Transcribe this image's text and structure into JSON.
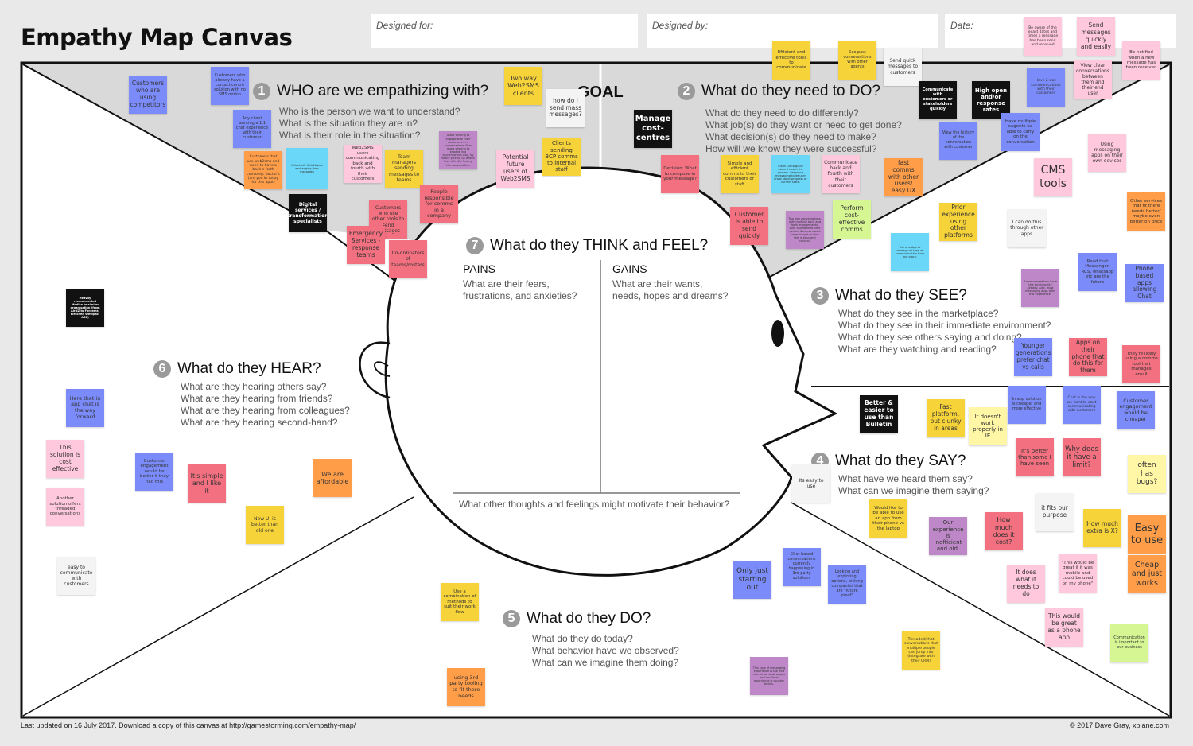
{
  "header": {
    "title": "Empathy Map Canvas",
    "designed_for_label": "Designed for:",
    "designed_by_label": "Designed by:",
    "date_label": "Date:"
  },
  "goal_label": "GOAL",
  "sections": {
    "who": {
      "number": "1",
      "title": "WHO are we empathizing with?",
      "questions": [
        "Who is the person we want to understand?",
        "What is the situation they are in?",
        "What is their role in the situation?"
      ]
    },
    "do_need": {
      "number": "2",
      "title": "What do they need to DO?",
      "questions": [
        "What do they need to do differently?",
        "What job(s) do they want or need to get done?",
        "What decision(s) do they need to make?",
        "How will we know they were successful?"
      ]
    },
    "see": {
      "number": "3",
      "title": "What do they SEE?",
      "questions": [
        "What do they see in the marketplace?",
        "What do they see in their immediate environment?",
        "What do they see others saying and doing?",
        "What are they watching and reading?"
      ]
    },
    "say": {
      "number": "4",
      "title": "What do they SAY?",
      "questions": [
        "What have we heard them say?",
        "What can we imagine them saying?"
      ]
    },
    "do": {
      "number": "5",
      "title": "What do they DO?",
      "questions": [
        "What do they do today?",
        "What behavior have we observed?",
        "What can we imagine them doing?"
      ]
    },
    "hear": {
      "number": "6",
      "title": "What do they HEAR?",
      "questions": [
        "What are they hearing others say?",
        "What are they hearing from friends?",
        "What are they hearing from colleagues?",
        "What are they hearing second-hand?"
      ]
    },
    "think": {
      "number": "7",
      "title": "What do they THINK and FEEL?",
      "pains_label": "PAINS",
      "pains_q": [
        "What are their fears,",
        "frustrations, and anxieties?"
      ],
      "gains_label": "GAINS",
      "gains_q": [
        "What are their wants,",
        "needs, hopes and dreams?"
      ],
      "other": "What other thoughts and feelings might motivate their behavior?"
    }
  },
  "colors": {
    "blue": "#7b8cfa",
    "pink": "#ffc8dc",
    "yellow": "#f7d33a",
    "lightyellow": "#fff6a6",
    "orange": "#ff9d48",
    "red": "#f2707f",
    "purple": "#be88c8",
    "cyan": "#6bd7f8",
    "black": "#111111",
    "white": "#f4f4f5",
    "green": "#d5f692"
  },
  "notes": [
    {
      "text": "Customers who are using competitors",
      "color": "blue",
      "section": "who"
    },
    {
      "text": "Customers who already have a contact centre solution with no SMS option",
      "color": "blue",
      "section": "who"
    },
    {
      "text": "Any client wanting a 1:1 chat experience with their customer",
      "color": "blue",
      "section": "who"
    },
    {
      "text": "Customers that use web2sms and need to have a back n forth convo eg: doctor's (are you in today for this appt)",
      "color": "orange",
      "section": "who"
    },
    {
      "text": "Potentially Web2Users exchanging their messages",
      "color": "cyan",
      "section": "who"
    },
    {
      "text": "Web2SMS users communicating back and fourth with their customers",
      "color": "pink",
      "section": "who"
    },
    {
      "text": "Team managers sending messages to teams",
      "color": "yellow",
      "section": "who"
    },
    {
      "text": "Users wishing to engage with their customers in a conversational flow. Users wishing to engage in a asynchronous way, by easily picking up where they left off / finding the conversation",
      "color": "purple",
      "section": "who"
    },
    {
      "text": "Two way Web2SMS clients",
      "color": "yellow",
      "section": "who"
    },
    {
      "text": "how do i send mass messages?",
      "color": "white",
      "section": "who"
    },
    {
      "text": "Clients sending BCP comms to internal staff",
      "color": "yellow",
      "section": "who"
    },
    {
      "text": "Potential future users of Web2SMS",
      "color": "pink",
      "section": "who"
    },
    {
      "text": "People responsible for comms in a company",
      "color": "red",
      "section": "who"
    },
    {
      "text": "Digital services / transformation specialists",
      "color": "black",
      "section": "who"
    },
    {
      "text": "Customers who use other tools to send messages",
      "color": "red",
      "section": "who"
    },
    {
      "text": "Emergency Services - response teams",
      "color": "red",
      "section": "who"
    },
    {
      "text": "Co-ordinators of teams/rosters",
      "color": "red",
      "section": "who"
    },
    {
      "text": "Efficient and effective tools to communicate",
      "color": "yellow",
      "section": "do_need"
    },
    {
      "text": "See past conversations with other agents",
      "color": "yellow",
      "section": "do_need"
    },
    {
      "text": "Send quick messages to customers",
      "color": "white",
      "section": "do_need"
    },
    {
      "text": "Communicate with customers or stakeholders quickly",
      "color": "black",
      "section": "do_need"
    },
    {
      "text": "High open and/or response rates",
      "color": "black",
      "section": "do_need"
    },
    {
      "text": "Be aware of the exact dates and times a message has been send and received",
      "color": "pink",
      "section": "do_need"
    },
    {
      "text": "Send messages quickly and easily",
      "color": "pink",
      "section": "do_need"
    },
    {
      "text": "Be notified when a new message has been received",
      "color": "pink",
      "section": "do_need"
    },
    {
      "text": "Have 2 way communications with their customers",
      "color": "blue",
      "section": "do_need"
    },
    {
      "text": "View clear conversations between them and their end user",
      "color": "pink",
      "section": "do_need"
    },
    {
      "text": "View the history of the conversation with customer",
      "color": "blue",
      "section": "do_need"
    },
    {
      "text": "Have multiple cagents be able to carry on the conversation",
      "color": "blue",
      "section": "do_need"
    },
    {
      "text": "Manage cost-centres",
      "color": "black",
      "section": "do_need"
    },
    {
      "text": "Decision: What to compose in your message?",
      "color": "red",
      "section": "do_need"
    },
    {
      "text": "Simple and efficient comms to their customers or staff",
      "color": "yellow",
      "section": "do_need"
    },
    {
      "text": "Clean UX to guide users through the process. Response messaging to let user know about progress or current state.",
      "color": "cyan",
      "section": "do_need"
    },
    {
      "text": "Communicate back and fourth with their customers",
      "color": "pink",
      "section": "do_need"
    },
    {
      "text": "fast comms with other users/ easy UX",
      "color": "orange",
      "section": "do_need"
    },
    {
      "text": "Customer is able to send quickly",
      "color": "red",
      "section": "do_need"
    },
    {
      "text": "Two way conversations, with multiple back and forth engagements, over a undefined time period. Success would be making it so that this is easy and natural.",
      "color": "purple",
      "section": "do_need"
    },
    {
      "text": "Perform cost-effective comms",
      "color": "green",
      "section": "do_need"
    },
    {
      "text": "Use one App to manage all type of communication from one place.",
      "color": "cyan",
      "section": "see"
    },
    {
      "text": "Prior experience using other platforms",
      "color": "yellow",
      "section": "see"
    },
    {
      "text": "CMS tools",
      "color": "pink",
      "section": "see"
    },
    {
      "text": "Using messaging apps on their own devices",
      "color": "pink",
      "section": "see"
    },
    {
      "text": "I can do this through other apps",
      "color": "white",
      "section": "see"
    },
    {
      "text": "Other services that fit there needs better/ maybe even better on price",
      "color": "orange",
      "section": "see"
    },
    {
      "text": "Some competitors have this functionality already. Also, most messaging apps offer this experience.",
      "color": "purple",
      "section": "see"
    },
    {
      "text": "Read that Messanger, RCS, whatsapp etc are the future",
      "color": "blue",
      "section": "see"
    },
    {
      "text": "Phone based apps allowing Chat",
      "color": "blue",
      "section": "see"
    },
    {
      "text": "Younger generations prefer chat vs calls",
      "color": "blue",
      "section": "see"
    },
    {
      "text": "Apps on their phone that do this for them",
      "color": "red",
      "section": "see"
    },
    {
      "text": "They're likely using a comms tool that manages email",
      "color": "red",
      "section": "see"
    },
    {
      "text": "Better & easier to use than Bulletin",
      "color": "black",
      "section": "say"
    },
    {
      "text": "Fast platform, but clunky in areas",
      "color": "yellow",
      "section": "say"
    },
    {
      "text": "It doesn't work properly in IE",
      "color": "lightyellow",
      "section": "say"
    },
    {
      "text": "In app solution is cheaper and more effective",
      "color": "blue",
      "section": "say"
    },
    {
      "text": "Chat is the way we want to start communicating with customers",
      "color": "blue",
      "section": "say"
    },
    {
      "text": "Customer engagement would be cheaper",
      "color": "blue",
      "section": "say"
    },
    {
      "text": "It's better than some I have seen",
      "color": "red",
      "section": "say"
    },
    {
      "text": "Why does it have a limit?",
      "color": "red",
      "section": "say"
    },
    {
      "text": "often has bugs?",
      "color": "lightyellow",
      "section": "say"
    },
    {
      "text": "Its easy to use",
      "color": "white",
      "section": "say"
    },
    {
      "text": "Would like to be able to use an app from their phone vs the laptop",
      "color": "yellow",
      "section": "say"
    },
    {
      "text": "Our experience is inefficient and old.",
      "color": "purple",
      "section": "say"
    },
    {
      "text": "How much does it cost?",
      "color": "red",
      "section": "say"
    },
    {
      "text": "it fits our purpose",
      "color": "white",
      "section": "say"
    },
    {
      "text": "How much extra is X?",
      "color": "yellow",
      "section": "say"
    },
    {
      "text": "Easy to use",
      "color": "orange",
      "section": "say"
    },
    {
      "text": "Cheap and just works",
      "color": "orange",
      "section": "say"
    },
    {
      "text": "It does what it needs to do",
      "color": "pink",
      "section": "say"
    },
    {
      "text": "\"This would be great if it was mobile and could be used on my phone\"",
      "color": "pink",
      "section": "say"
    },
    {
      "text": "This would be great as a phone app",
      "color": "pink",
      "section": "say"
    },
    {
      "text": "Communication is important to our business",
      "color": "green",
      "section": "say"
    },
    {
      "text": "Threaded/chat conversations that multiple people can jump into (integrate with their CRM)",
      "color": "yellow",
      "section": "do"
    },
    {
      "text": "Only just starting out",
      "color": "blue",
      "section": "do"
    },
    {
      "text": "Chat based conversations currently happening in 3rd party solutions",
      "color": "blue",
      "section": "do"
    },
    {
      "text": "Looking and exploring options, picking companies that are \"future proof\"",
      "color": "blue",
      "section": "do"
    },
    {
      "text": "This type of messaging experience is the new normal for most people and our Omni experience is counter to this.",
      "color": "purple",
      "section": "do"
    },
    {
      "text": "Use a combination of methods to suit their work flow",
      "color": "yellow",
      "section": "do"
    },
    {
      "text": "using 3rd party tooling to fit there needs",
      "color": "orange",
      "section": "do"
    },
    {
      "text": "Heavily recommended Modica to similar organisation (from AirNZ to Fonterra, Fletcher, Westpac, ASB)",
      "color": "black",
      "section": "hear"
    },
    {
      "text": "Here that in app chat is the way forward",
      "color": "blue",
      "section": "hear"
    },
    {
      "text": "This solution is cost effective",
      "color": "pink",
      "section": "hear"
    },
    {
      "text": "Another solution offers threaded conversations",
      "color": "pink",
      "section": "hear"
    },
    {
      "text": "easy to communicate with customers",
      "color": "white",
      "section": "hear"
    },
    {
      "text": "Customer engagement would be better if they had this",
      "color": "blue",
      "section": "hear"
    },
    {
      "text": "It's simple and I like it",
      "color": "red",
      "section": "hear"
    },
    {
      "text": "We are affordable",
      "color": "orange",
      "section": "hear"
    },
    {
      "text": "New UI is better than old one",
      "color": "yellow",
      "section": "hear"
    }
  ],
  "footer": {
    "left": "Last updated on 16 July 2017. Download a copy of this canvas at http://gamestorming.com/empathy-map/",
    "right": "© 2017 Dave Gray, xplane.com"
  }
}
